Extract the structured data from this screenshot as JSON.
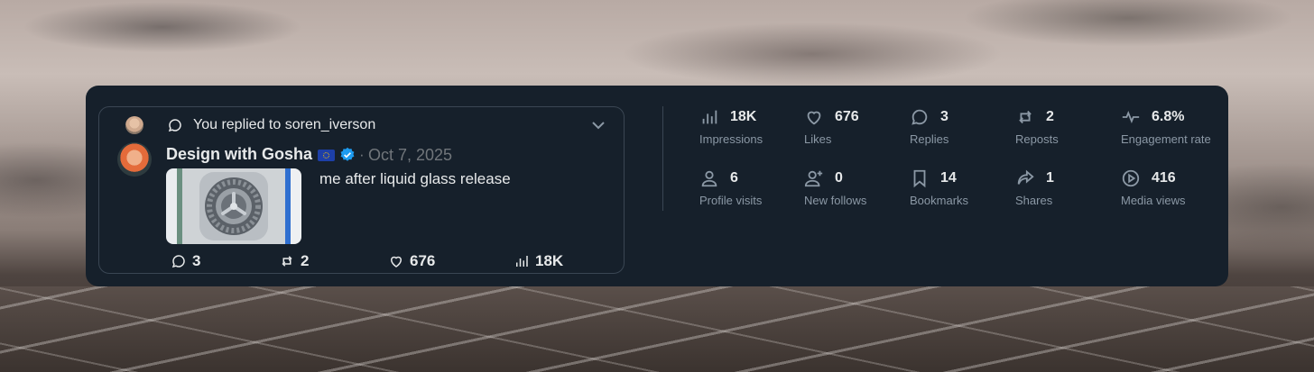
{
  "reply_context": {
    "text": "You replied to soren_iverson"
  },
  "tweet": {
    "author": "Design with Gosha",
    "separator": "·",
    "date": "Oct 7, 2025",
    "text": "me after liquid glass release",
    "actions": {
      "replies": "3",
      "reposts": "2",
      "likes": "676",
      "views": "18K"
    }
  },
  "stats": [
    {
      "icon": "bar-chart-icon",
      "value": "18K",
      "label": "Impressions"
    },
    {
      "icon": "heart-icon",
      "value": "676",
      "label": "Likes"
    },
    {
      "icon": "reply-icon",
      "value": "3",
      "label": "Replies"
    },
    {
      "icon": "repost-icon",
      "value": "2",
      "label": "Reposts"
    },
    {
      "icon": "activity-icon",
      "value": "6.8%",
      "label": "Engagement rate"
    },
    {
      "icon": "person-icon",
      "value": "6",
      "label": "Profile visits"
    },
    {
      "icon": "add-person-icon",
      "value": "0",
      "label": "New follows"
    },
    {
      "icon": "bookmark-icon",
      "value": "14",
      "label": "Bookmarks"
    },
    {
      "icon": "share-icon",
      "value": "1",
      "label": "Shares"
    },
    {
      "icon": "play-icon",
      "value": "416",
      "label": "Media views"
    }
  ],
  "colors": {
    "panel": "#16202b",
    "text": "#e7e9ea",
    "muted": "#8b98a5",
    "verified": "#1d9bf0"
  }
}
